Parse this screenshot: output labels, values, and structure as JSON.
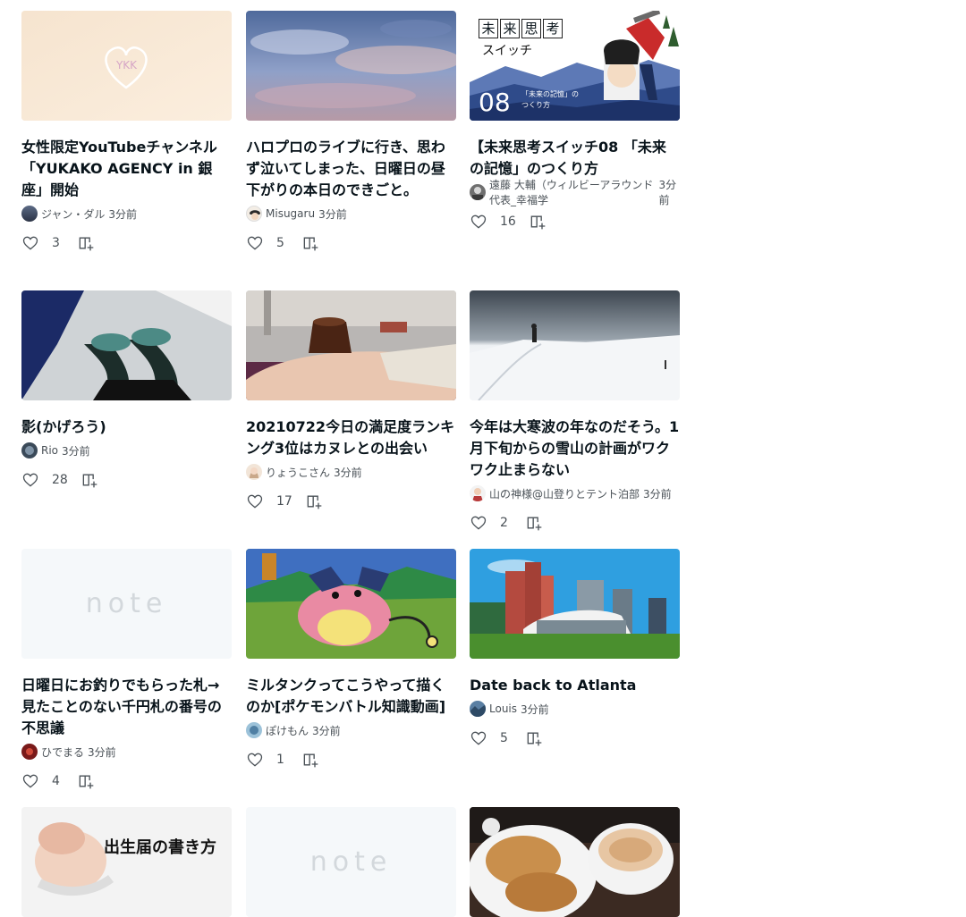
{
  "cards": [
    {
      "title": "女性限定YouTubeチャンネル「YUKAKO AGENCY in 銀座」開始",
      "author": "ジャン・ダル",
      "time": "3分前",
      "likes": "3",
      "thumb_text": "YKK"
    },
    {
      "title": "ハロプロのライブに行き、思わず泣いてしまった、日曜日の昼下がりの本日のできごと。",
      "author": "Misugaru",
      "time": "3分前",
      "likes": "5"
    },
    {
      "title": "【未来思考スイッチ08 「未来の記憶」のつくり方",
      "author": "遠藤 大輔（ウィルビーアラウンド代表_幸福学",
      "time": "3分前",
      "likes": "16",
      "thumb_lines": [
        "未",
        "来",
        "思",
        "考"
      ],
      "thumb_sub": "スイッチ",
      "thumb_num": "08",
      "thumb_caption1": "「未来の記憶」の",
      "thumb_caption2": "つくり方"
    },
    {
      "title": "影(かげろう)",
      "author": "Rio",
      "time": "3分前",
      "likes": "28"
    },
    {
      "title": "20210722今日の満足度ランキング3位はカヌレとの出会い",
      "author": "りょうこさん",
      "time": "3分前",
      "likes": "17"
    },
    {
      "title": "今年は大寒波の年なのだそう。1月下旬からの雪山の計画がワクワク止まらない",
      "author": "山の神様@山登りとテント泊部",
      "time": "3分前",
      "likes": "2"
    },
    {
      "title": "日曜日にお釣りでもらった札→見たことのない千円札の番号の不思議",
      "author": "ひでまる",
      "time": "3分前",
      "likes": "4"
    },
    {
      "title": "ミルタンクってこうやって描くのか[ポケモンバトル知識動画]",
      "author": "ぽけもん",
      "time": "3分前",
      "likes": "1"
    },
    {
      "title": "Date back to Atlanta",
      "author": "Louis",
      "time": "3分前",
      "likes": "5"
    },
    {
      "thumb_text": "出生届の書き方"
    },
    {
      "thumb_text": "note"
    },
    {}
  ],
  "placeholder_logo": "note",
  "colors": {
    "text": "#08131a",
    "muted": "#4a5157",
    "icon": "#888f95"
  }
}
